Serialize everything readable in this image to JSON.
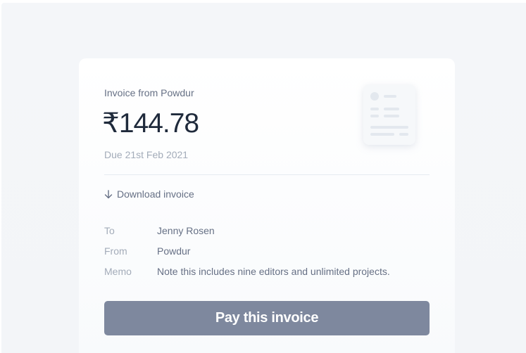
{
  "invoice": {
    "header": "Invoice from Powdur",
    "amount": "₹144.78",
    "due": "Due 21st Feb 2021",
    "download_label": "Download invoice",
    "details": [
      {
        "key": "To",
        "value": "Jenny Rosen"
      },
      {
        "key": "From",
        "value": "Powdur"
      },
      {
        "key": "Memo",
        "value": "Note this includes nine editors and unlimited projects."
      }
    ],
    "pay_button_label": "Pay this invoice"
  },
  "icons": {
    "download": "arrow-down-icon",
    "illustration": "invoice-document-icon"
  },
  "colors": {
    "page_background": "#f3f5f8",
    "card_background": "#ffffff",
    "amount_text": "#1f2a3b",
    "muted_text": "#a3acb9",
    "secondary_text": "#667085",
    "button_background": "#7e889e",
    "button_text": "#ffffff"
  }
}
